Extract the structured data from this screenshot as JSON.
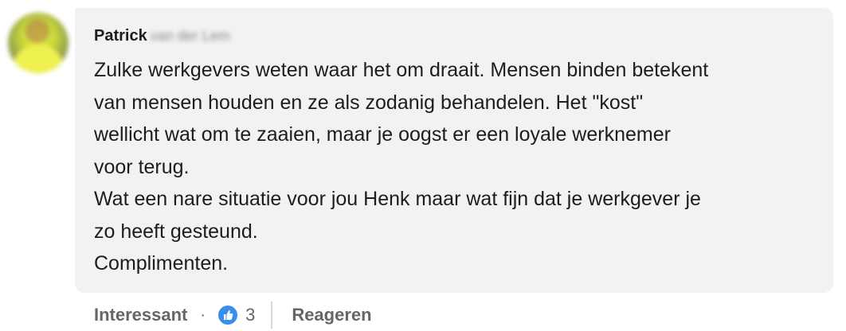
{
  "comment": {
    "author": {
      "name": "Patrick",
      "name_rest": "van der Lem"
    },
    "lines": [
      "Zulke werkgevers weten waar het om draait. Mensen binden betekent",
      "van mensen houden en ze als zodanig behandelen. Het \"kost\"",
      "wellicht wat om te zaaien, maar je oogst er een loyale werknemer",
      "voor terug.",
      "Wat een nare situatie voor jou Henk maar wat fijn dat je werkgever je",
      "zo heeft gesteund.",
      "Complimenten."
    ]
  },
  "actions": {
    "react_label": "Interessant",
    "separator": "·",
    "reaction_icon": "thumbs-up-icon",
    "reaction_count": "3",
    "reply_label": "Reageren"
  },
  "colors": {
    "bubble_bg": "#f2f2f2",
    "reaction_blue": "#378fe9",
    "muted_text": "#666666"
  }
}
